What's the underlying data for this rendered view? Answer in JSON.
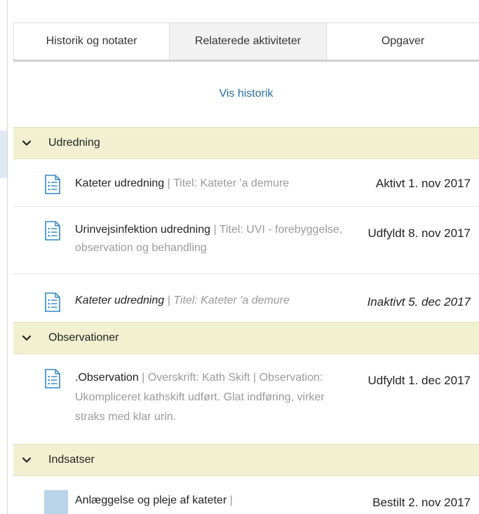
{
  "tabs": [
    {
      "label": "Historik og notater"
    },
    {
      "label": "Relaterede aktiviteter"
    },
    {
      "label": "Opgaver"
    }
  ],
  "history_link": "Vis historik",
  "sections": [
    {
      "title": "Udredning",
      "rows": [
        {
          "title": "Kateter udredning",
          "sub": " | Titel: Kateter 'a demure",
          "status": "Aktivt 1. nov 2017"
        },
        {
          "title": "Urinvejsinfektion udredning",
          "sub": " | Titel: UVI - forebyggelse, observation og behandling",
          "status": "Udfyldt 8. nov 2017"
        },
        {
          "title": "Kateter udredning",
          "sub": " | Titel: Kateter 'a demure",
          "status": "Inaktivt 5. dec 2017"
        }
      ]
    },
    {
      "title": "Observationer",
      "rows": [
        {
          "title": ".Observation",
          "sub": " | Overskrift: Kath Skift | Observation: Ukompliceret kathskift udført. Glat indføring, virker straks med klar urin.",
          "status": "Udfyldt 1. dec 2017"
        }
      ]
    },
    {
      "title": "Indsatser",
      "rows": [
        {
          "title": "Anlæggelse og pleje af kateter",
          "sub": " |",
          "status": "Bestilt 2. nov 2017"
        }
      ]
    }
  ],
  "colors": {
    "section_bg": "#f3f0d2",
    "link": "#2b6fa6",
    "doc_icon": "#2f86c9",
    "subtext": "#9a9a9a"
  }
}
